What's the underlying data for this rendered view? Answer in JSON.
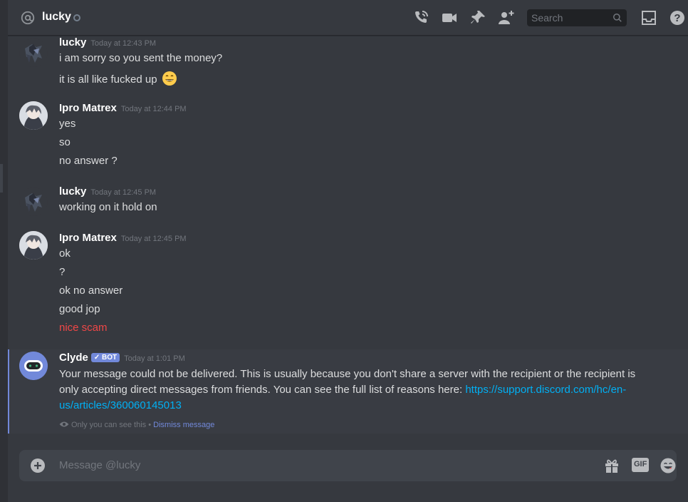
{
  "header": {
    "title": "lucky",
    "search_placeholder": "Search"
  },
  "messages": [
    {
      "author": "lucky",
      "timestamp": "Today at 12:43 PM",
      "lines": [
        "i am sorry so you sent the money?",
        "it is all like fucked up"
      ]
    },
    {
      "author": "Ipro Matrex",
      "timestamp": "Today at 12:44 PM",
      "lines": [
        "yes",
        "so",
        "no answer ?"
      ]
    },
    {
      "author": "lucky",
      "timestamp": "Today at 12:45 PM",
      "lines": [
        "working on it hold on"
      ]
    },
    {
      "author": "Ipro Matrex",
      "timestamp": "Today at 12:45 PM",
      "lines": [
        "ok",
        "?",
        "ok no answer",
        "good jop",
        "nice scam"
      ]
    }
  ],
  "clyde": {
    "author": "Clyde",
    "bot_tag": "BOT",
    "timestamp": "Today at 1:01 PM",
    "body_text": "Your message could not be delivered. This is usually because you don't share a server with the recipient or the recipient is only accepting direct messages from friends. You can see the full list of reasons here: ",
    "link": "https://support.discord.com/hc/en-us/articles/360060145013",
    "ephemeral_note": "Only you can see this",
    "separator": "•",
    "dismiss_label": "Dismiss message"
  },
  "composer": {
    "placeholder": "Message @lucky",
    "gif_label": "GIF"
  },
  "colors": {
    "background": "#36393f",
    "accent": "#7289da",
    "link": "#00b0f4",
    "error_text": "#f04747"
  }
}
